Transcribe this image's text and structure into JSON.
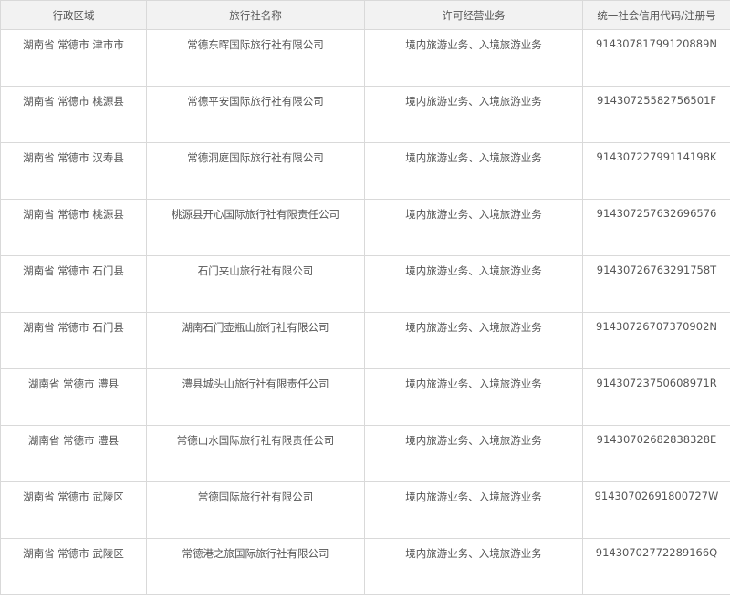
{
  "table": {
    "headers": [
      "行政区域",
      "旅行社名称",
      "许可经营业务",
      "统一社会信用代码/注册号"
    ],
    "rows": [
      [
        "湖南省 常德市 津市市",
        "常德东晖国际旅行社有限公司",
        "境内旅游业务、入境旅游业务",
        "91430781799120889N"
      ],
      [
        "湖南省 常德市 桃源县",
        "常德平安国际旅行社有限公司",
        "境内旅游业务、入境旅游业务",
        "91430725582756501F"
      ],
      [
        "湖南省 常德市 汉寿县",
        "常德洞庭国际旅行社有限公司",
        "境内旅游业务、入境旅游业务",
        "91430722799114198K"
      ],
      [
        "湖南省 常德市 桃源县",
        "桃源县开心国际旅行社有限责任公司",
        "境内旅游业务、入境旅游业务",
        "91430725763269657​6"
      ],
      [
        "湖南省 常德市 石门县",
        "石门夹山旅行社有限公司",
        "境内旅游业务、入境旅游业务",
        "91430726763291758T"
      ],
      [
        "湖南省 常德市 石门县",
        "湖南石门壶瓶山旅行社有限公司",
        "境内旅游业务、入境旅游业务",
        "91430726707370902N"
      ],
      [
        "湖南省 常德市 澧县",
        "澧县城头山旅行社有限责任公司",
        "境内旅游业务、入境旅游业务",
        "91430723750608971R"
      ],
      [
        "湖南省 常德市 澧县",
        "常德山水国际旅行社有限责任公司",
        "境内旅游业务、入境旅游业务",
        "91430702682838328E"
      ],
      [
        "湖南省 常德市 武陵区",
        "常德国际旅行社有限公司",
        "境内旅游业务、入境旅游业务",
        "91430702691800727W"
      ],
      [
        "湖南省 常德市 武陵区",
        "常德港之旅国际旅行社有限公司",
        "境内旅游业务、入境旅游业务",
        "91430702772289166Q"
      ]
    ]
  }
}
